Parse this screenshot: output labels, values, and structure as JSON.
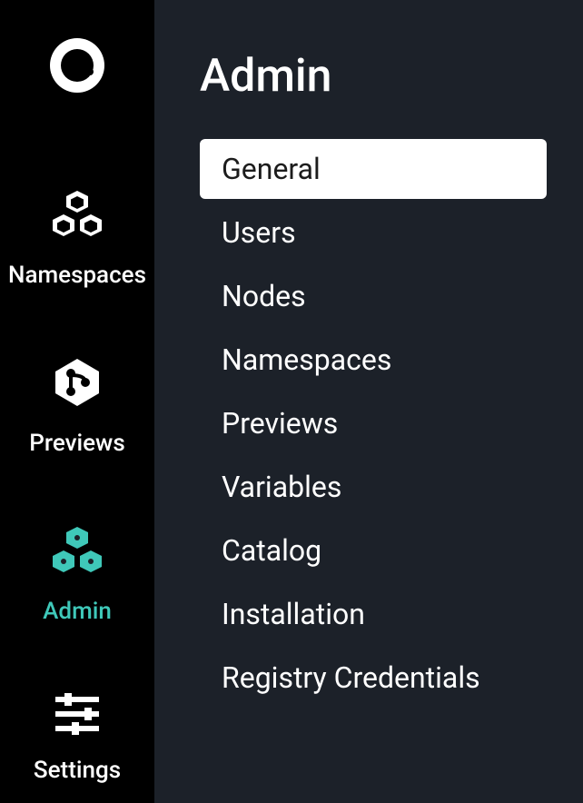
{
  "sidebar": {
    "items": [
      {
        "label": "Namespaces"
      },
      {
        "label": "Previews"
      },
      {
        "label": "Admin"
      },
      {
        "label": "Settings"
      }
    ]
  },
  "page": {
    "title": "Admin"
  },
  "menu": {
    "items": [
      {
        "label": "General"
      },
      {
        "label": "Users"
      },
      {
        "label": "Nodes"
      },
      {
        "label": "Namespaces"
      },
      {
        "label": "Previews"
      },
      {
        "label": "Variables"
      },
      {
        "label": "Catalog"
      },
      {
        "label": "Installation"
      },
      {
        "label": "Registry Credentials"
      }
    ]
  }
}
